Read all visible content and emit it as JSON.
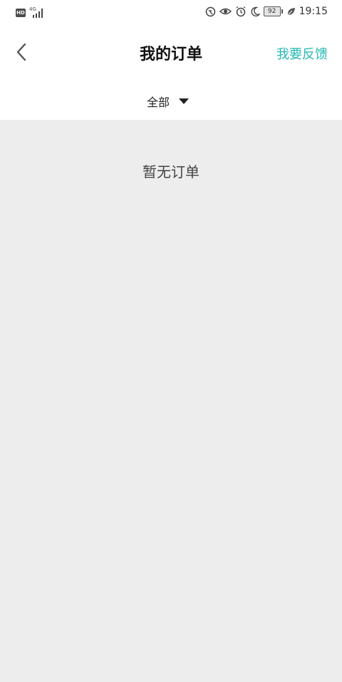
{
  "status_bar": {
    "left_badge": "HD",
    "network_type": "4G",
    "battery_level": "92",
    "time": "19:15",
    "icons": [
      "hd-icon",
      "signal-icon",
      "data-usage-icon",
      "eye-comfort-icon",
      "alarm-icon",
      "do-not-disturb-moon-icon",
      "battery-icon",
      "power-saving-leaf-icon"
    ]
  },
  "header": {
    "back_icon": "chevron-left-icon",
    "title": "我的订单",
    "feedback_label": "我要反馈",
    "accent_color": "#25b8b3"
  },
  "filter": {
    "selected": "全部",
    "dropdown_icon": "caret-down-icon"
  },
  "main": {
    "empty_message": "暂无订单",
    "background_color": "#ededed"
  }
}
